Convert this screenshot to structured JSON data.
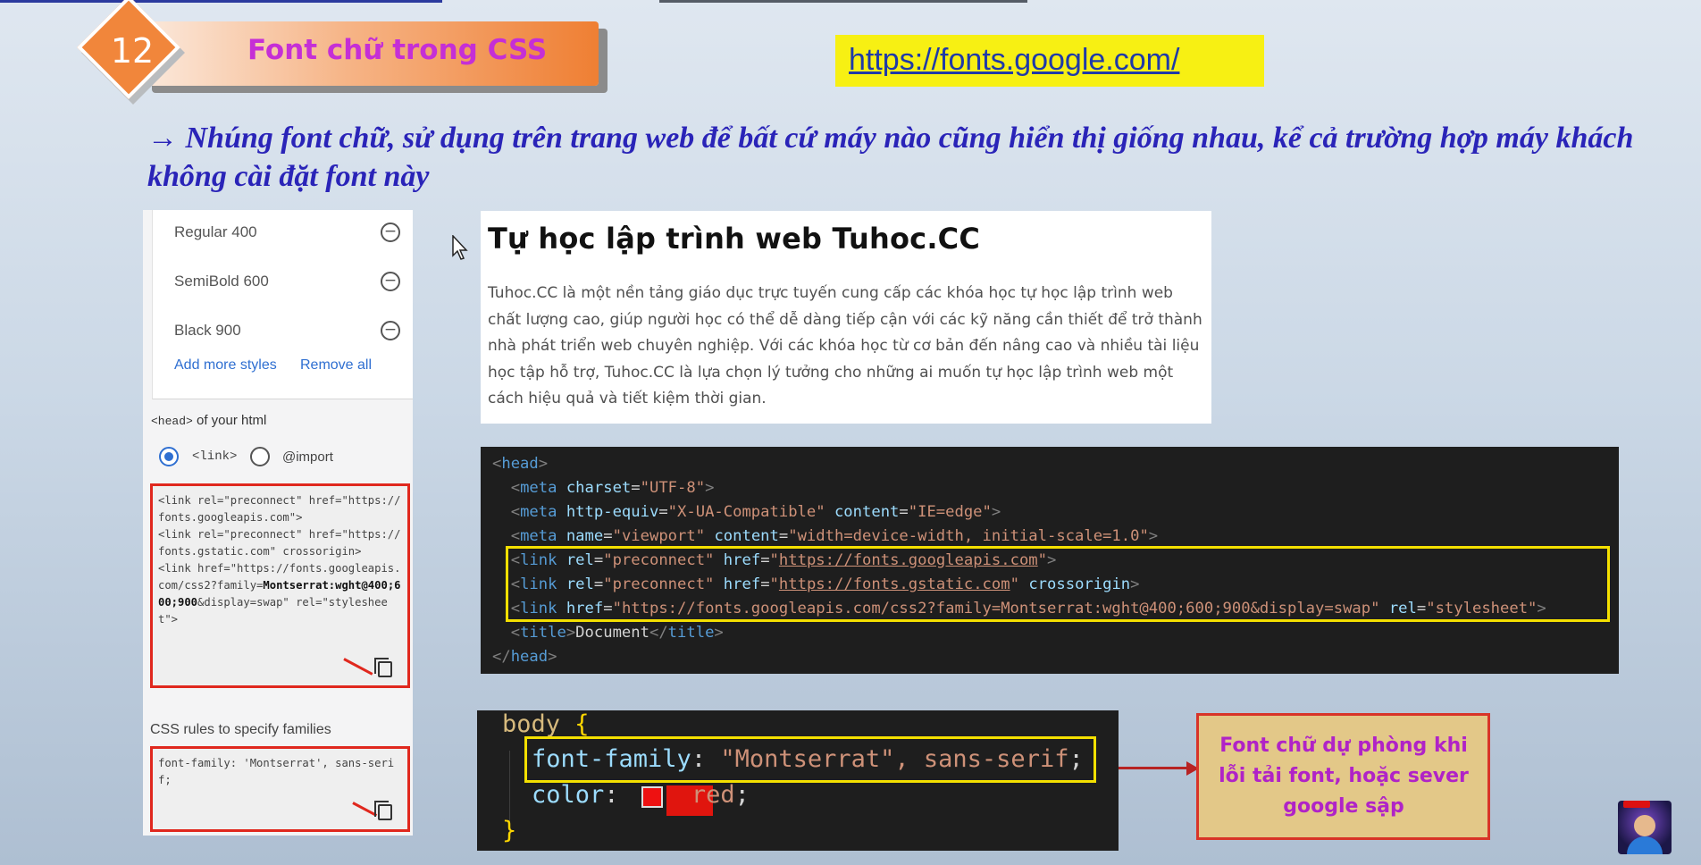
{
  "slide": {
    "number": "12",
    "title": "Font chữ trong CSS",
    "url": "https://fonts.google.com/",
    "headline": "→ Nhúng font chữ, sử dụng trên trang web để bất cứ máy nào cũng hiển thị giống nhau, kể cả trường hợp máy khách không cài đặt font này"
  },
  "google_fonts_panel": {
    "styles": [
      {
        "label": "Regular 400"
      },
      {
        "label": "SemiBold 600"
      },
      {
        "label": "Black 900"
      }
    ],
    "add_more_styles": "Add more styles",
    "remove_all": "Remove all",
    "head_label_tag": "<head>",
    "head_label_text": " of your html",
    "radio_link": "<link>",
    "radio_import": "@import",
    "embed_code_plain1": "<link rel=\"preconnect\" href=\"https://fonts.googleapis.com\">\n<link rel=\"preconnect\" href=\"https://fonts.gstatic.com\" crossorigin>\n<link href=\"https://fonts.googleapis.com/css2?family=",
    "embed_code_bold": "Montserrat:wght@400;600;900",
    "embed_code_plain2": "&display=swap\" rel=\"stylesheet\">",
    "css_rules_label": "CSS rules to specify families",
    "css_rule_code": "font-family: 'Montserrat', sans-serif;"
  },
  "preview": {
    "title": "Tự học lập trình web Tuhoc.CC",
    "body": "Tuhoc.CC là một nền tảng giáo dục trực tuyến cung cấp các khóa học tự học lập trình web chất lượng cao, giúp người học có thể dễ dàng tiếp cận với các kỹ năng cần thiết để trở thành nhà phát triển web chuyên nghiệp. Với các khóa học từ cơ bản đến nâng cao và nhiều tài liệu học tập hỗ trợ, Tuhoc.CC là lựa chọn lý tưởng cho những ai muốn tự học lập trình web một cách hiệu quả và tiết kiệm thời gian."
  },
  "html_code": {
    "head_open": "head",
    "meta": "meta",
    "link": "link",
    "title_tag": "title",
    "charset_attr": "charset",
    "charset_val": "\"UTF-8\"",
    "http_equiv_attr": "http-equiv",
    "http_equiv_val": "\"X-UA-Compatible\"",
    "content_attr": "content",
    "content_val1": "\"IE=edge\"",
    "name_attr": "name",
    "name_val": "\"viewport\"",
    "content_val2": "\"width=device-width, initial-scale=1.0\"",
    "rel_attr": "rel",
    "rel_val": "\"preconnect\"",
    "href_attr": "href",
    "href1": "https://fonts.googleapis.com",
    "href2": "https://fonts.gstatic.com",
    "crossorigin": "crossorigin",
    "href3": "\"https://fonts.googleapis.com/css2?family=Montserrat:wght@400;600;900&display=swap\"",
    "rel_val2": "\"stylesheet\"",
    "title_text": "Document"
  },
  "css_code": {
    "selector": "body",
    "font_family_prop": "font-family",
    "font_family_val": "\"Montserrat\", sans-serif",
    "color_prop": "color",
    "color_val": "red"
  },
  "callout": {
    "text": "Font chữ dự phòng khi lỗi tải font, hoặc sever google sập"
  },
  "colors": {
    "accent_orange": "#f1863b",
    "title_magenta": "#c52fd6",
    "headline_blue": "#2a24b8",
    "highlight_yellow": "#f7f013",
    "box_red": "#e0281e"
  }
}
